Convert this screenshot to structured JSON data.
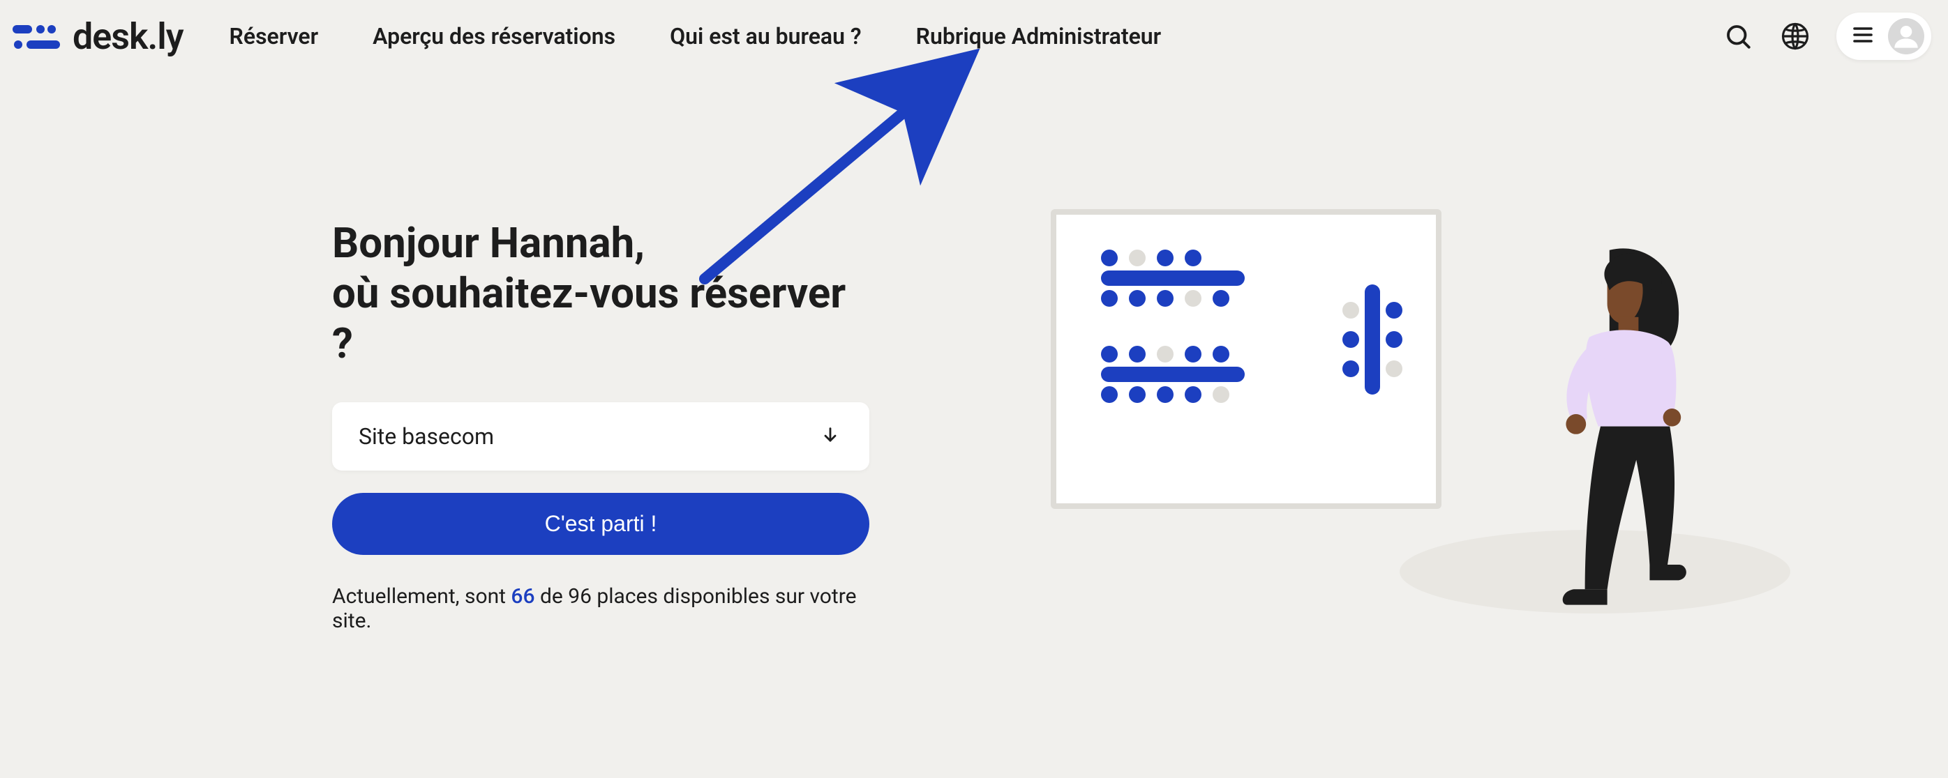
{
  "brand": {
    "name": "desk.ly"
  },
  "nav": {
    "items": [
      {
        "label": "Réserver"
      },
      {
        "label": "Aperçu des réservations"
      },
      {
        "label": "Qui est au bureau ?"
      },
      {
        "label": "Rubrique Administrateur"
      }
    ]
  },
  "greeting": {
    "line1": "Bonjour Hannah,",
    "line2": "où souhaitez-vous réserver ?"
  },
  "site_select": {
    "value": "Site basecom"
  },
  "cta": {
    "label": "C'est parti !"
  },
  "availability": {
    "prefix": "Actuellement, sont ",
    "count": "66",
    "middle": " de 96 places disponibles sur votre site."
  },
  "colors": {
    "brand_blue": "#1c3fc0",
    "text": "#1d1d1d",
    "bg": "#f1f0ed"
  }
}
